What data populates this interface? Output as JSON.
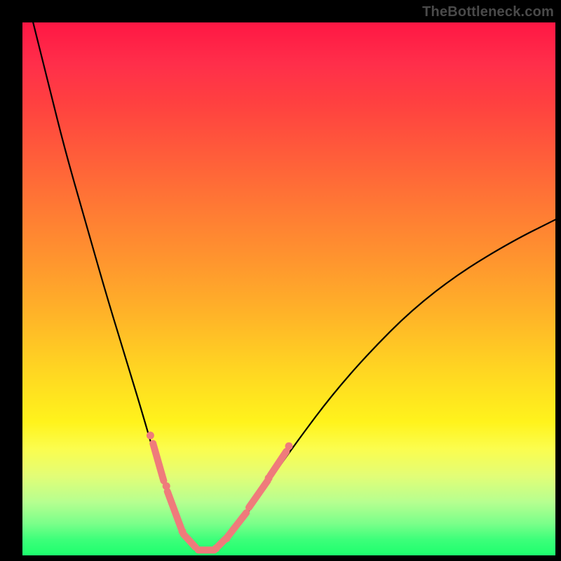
{
  "watermark": "TheBottleneck.com",
  "chart_data": {
    "type": "line",
    "title": "",
    "xlabel": "",
    "ylabel": "",
    "xlim": [
      0,
      100
    ],
    "ylim": [
      0,
      100
    ],
    "grid": false,
    "legend": false,
    "series": [
      {
        "name": "bottleneck-curve",
        "x": [
          2,
          5,
          8,
          12,
          16,
          20,
          23,
          25,
          27,
          29,
          30,
          32,
          33,
          34.5,
          36,
          38,
          40,
          43,
          47,
          52,
          58,
          65,
          73,
          82,
          92,
          100
        ],
        "y": [
          100,
          88,
          76,
          62,
          48,
          35,
          25,
          18,
          12,
          7,
          4,
          2,
          1,
          0.5,
          1,
          2.5,
          5,
          9,
          15,
          22,
          30,
          38,
          46,
          53,
          59,
          63
        ]
      }
    ],
    "markers": {
      "name": "highlighted-points",
      "color": "#ef7b7b",
      "segments": [
        {
          "from": [
            24.5,
            21
          ],
          "to": [
            26.5,
            14
          ]
        },
        {
          "from": [
            27.2,
            12
          ],
          "to": [
            29.8,
            5
          ]
        },
        {
          "from": [
            30.2,
            4
          ],
          "to": [
            32.5,
            1.5
          ]
        },
        {
          "from": [
            33.0,
            1
          ],
          "to": [
            36.0,
            1
          ]
        },
        {
          "from": [
            36.5,
            1.5
          ],
          "to": [
            38.0,
            3
          ]
        },
        {
          "from": [
            38.5,
            3.5
          ],
          "to": [
            42.0,
            8
          ]
        },
        {
          "from": [
            42.5,
            9
          ],
          "to": [
            46.0,
            14
          ]
        },
        {
          "from": [
            46.5,
            15
          ],
          "to": [
            49.5,
            19.5
          ]
        }
      ],
      "dots": [
        [
          24.0,
          22.5
        ],
        [
          27.0,
          13.0
        ],
        [
          30.0,
          4.5
        ],
        [
          36.3,
          1.3
        ],
        [
          38.3,
          3.2
        ],
        [
          46.2,
          14.5
        ],
        [
          50.0,
          20.5
        ]
      ]
    },
    "background_gradient": {
      "top": "#ff1744",
      "mid": "#ffd522",
      "bottom": "#1dff6d"
    }
  }
}
